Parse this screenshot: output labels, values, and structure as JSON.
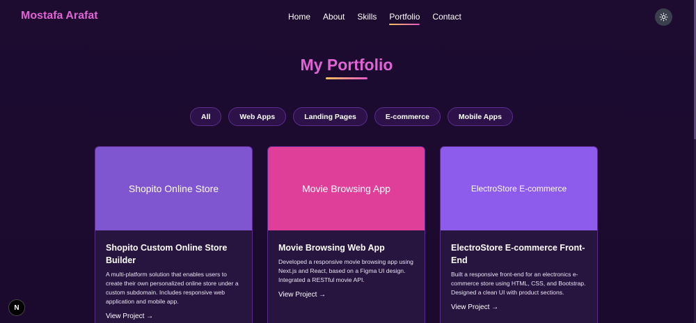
{
  "brand": "Mostafa Arafat",
  "nav": {
    "items": [
      "Home",
      "About",
      "Skills",
      "Portfolio",
      "Contact"
    ],
    "active": "Portfolio"
  },
  "theme_toggle_icon": "sun-icon",
  "section": {
    "title": "My Portfolio"
  },
  "filters": [
    "All",
    "Web Apps",
    "Landing Pages",
    "E-commerce",
    "Mobile Apps"
  ],
  "projects": [
    {
      "banner_text": "Shopito Online Store",
      "banner_color": "#7f56cf",
      "title": "Shopito Custom Online Store Builder",
      "description": "A multi-platform solution that enables users to create their own personalized online store under a custom subdomain. Includes responsive web application and mobile app.",
      "link": "View Project →"
    },
    {
      "banner_text": "Movie Browsing App",
      "banner_color": "#df3f99",
      "title": "Movie Browsing Web App",
      "description": "Developed a responsive movie browsing app using Next.js and React, based on a Figma UI design. Integrated a RESTful movie API.",
      "link": "View Project →"
    },
    {
      "banner_text": "ElectroStore E-commerce",
      "banner_color": "#8d5ced",
      "title": "ElectroStore E-commerce Front-End",
      "description": "Built a responsive front-end for an electronics e-commerce store using HTML, CSS, and Bootstrap. Designed a clean UI with product sections.",
      "link": "View Project →"
    }
  ],
  "dev_badge": "N"
}
